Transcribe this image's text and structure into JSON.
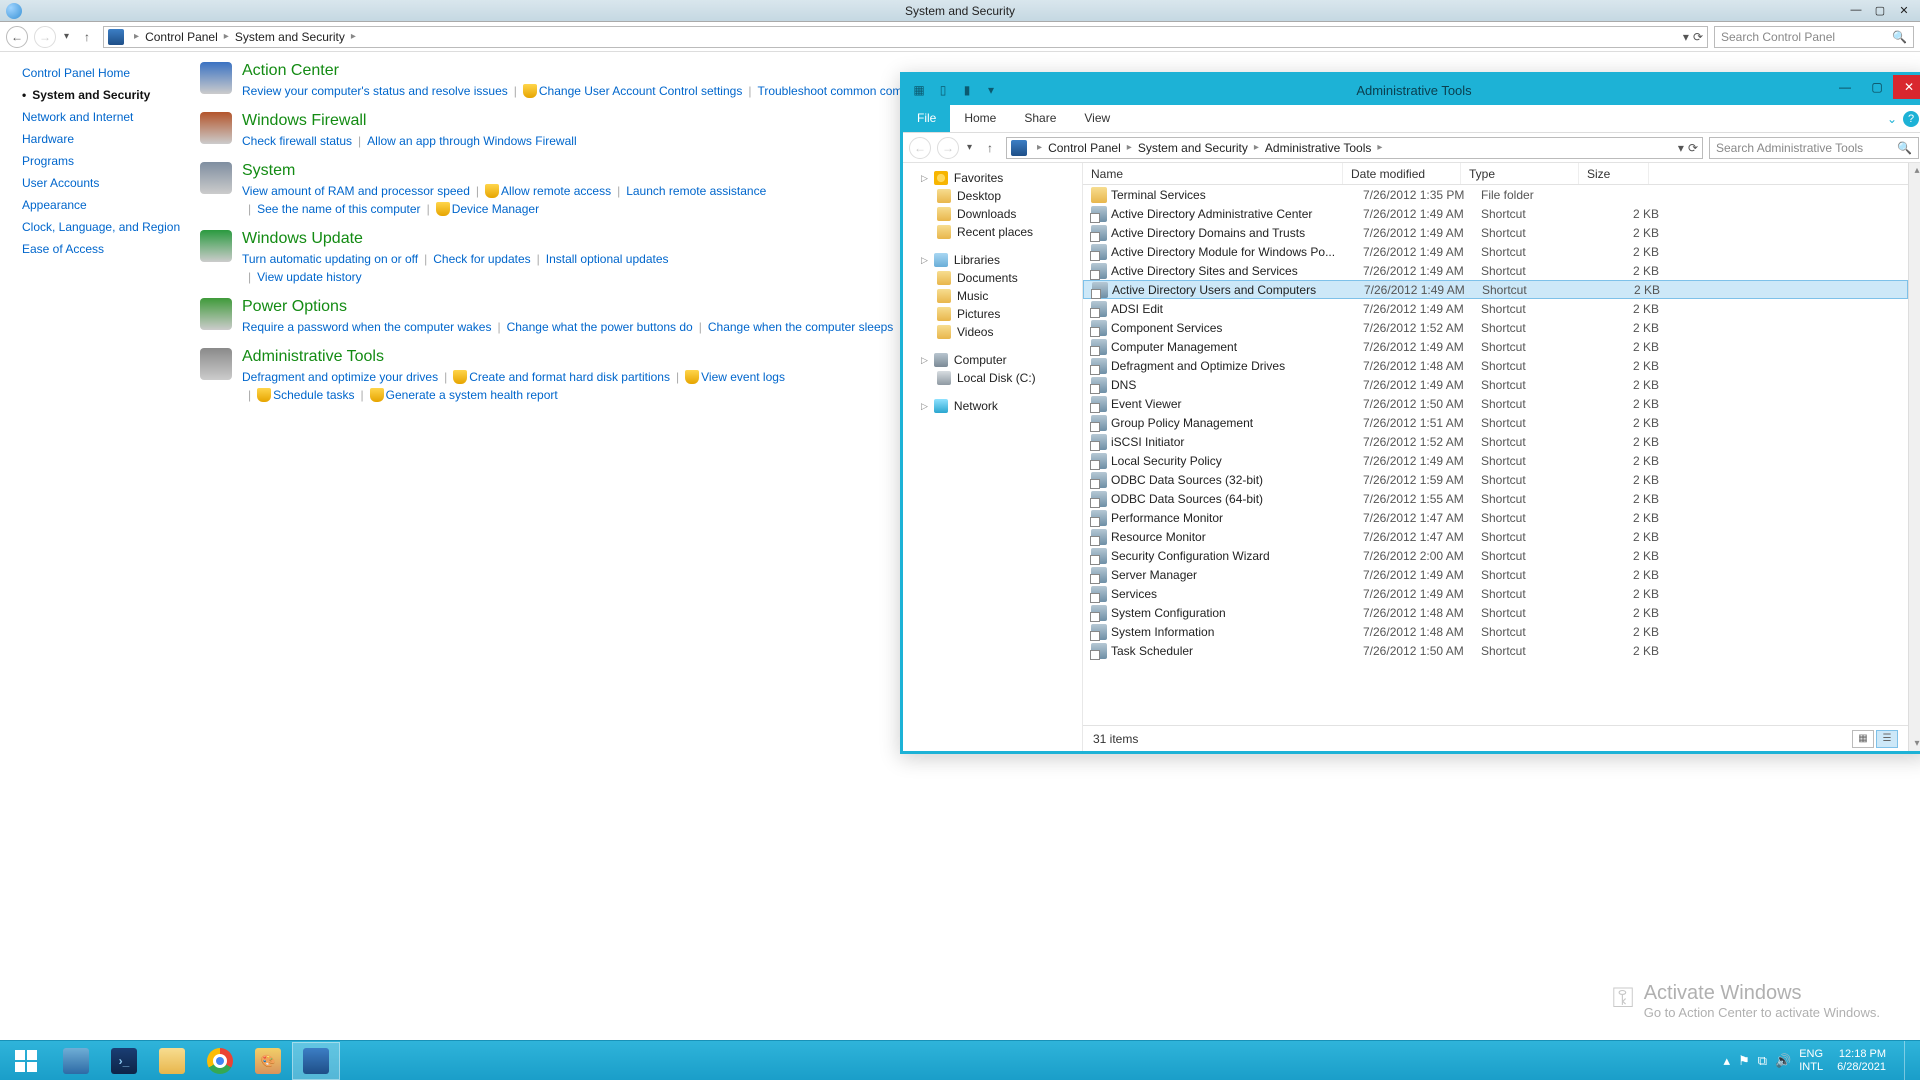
{
  "mainWindow": {
    "title": "System and Security",
    "breadcrumb": [
      "Control Panel",
      "System and Security"
    ],
    "searchPlaceholder": "Search Control Panel"
  },
  "sidebar": [
    {
      "label": "Control Panel Home",
      "active": false
    },
    {
      "label": "System and Security",
      "active": true
    },
    {
      "label": "Network and Internet",
      "active": false
    },
    {
      "label": "Hardware",
      "active": false
    },
    {
      "label": "Programs",
      "active": false
    },
    {
      "label": "User Accounts",
      "active": false
    },
    {
      "label": "Appearance",
      "active": false
    },
    {
      "label": "Clock, Language, and Region",
      "active": false
    },
    {
      "label": "Ease of Access",
      "active": false
    }
  ],
  "sections": [
    {
      "title": "Action Center",
      "links": [
        {
          "t": "Review your computer's status and resolve issues"
        },
        {
          "t": "Change User Account Control settings",
          "shield": true
        },
        {
          "t": "Troubleshoot common computer problems"
        }
      ],
      "icon": "#3a72c2"
    },
    {
      "title": "Windows Firewall",
      "links": [
        {
          "t": "Check firewall status"
        },
        {
          "t": "Allow an app through Windows Firewall"
        }
      ],
      "icon": "#b3552b"
    },
    {
      "title": "System",
      "links": [
        {
          "t": "View amount of RAM and processor speed"
        },
        {
          "t": "Allow remote access",
          "shield": true
        },
        {
          "t": "Launch remote assistance"
        },
        {
          "t": "See the name of this computer"
        },
        {
          "t": "Device Manager",
          "shield": true
        }
      ],
      "icon": "#7f8ea0"
    },
    {
      "title": "Windows Update",
      "links": [
        {
          "t": "Turn automatic updating on or off"
        },
        {
          "t": "Check for updates"
        },
        {
          "t": "Install optional updates"
        },
        {
          "t": "View update history"
        }
      ],
      "icon": "#2a9a3f"
    },
    {
      "title": "Power Options",
      "links": [
        {
          "t": "Require a password when the computer wakes"
        },
        {
          "t": "Change what the power buttons do"
        },
        {
          "t": "Change when the computer sleeps"
        }
      ],
      "icon": "#3f9a3a"
    },
    {
      "title": "Administrative Tools",
      "links": [
        {
          "t": "Defragment and optimize your drives"
        },
        {
          "t": "Create and format hard disk partitions",
          "shield": true
        },
        {
          "t": "View event logs",
          "shield": true
        },
        {
          "t": "Schedule tasks",
          "shield": true
        },
        {
          "t": "Generate a system health report",
          "shield": true
        }
      ],
      "icon": "#8a8a8a"
    }
  ],
  "subWindow": {
    "title": "Administrative Tools",
    "ribbonTabs": [
      "File",
      "Home",
      "Share",
      "View"
    ],
    "breadcrumb": [
      "Control Panel",
      "System and Security",
      "Administrative Tools"
    ],
    "searchPlaceholder": "Search Administrative Tools",
    "columns": [
      "Name",
      "Date modified",
      "Type",
      "Size"
    ],
    "status": "31 items",
    "navPane": [
      {
        "header": "Favorites",
        "icon": "icon-star",
        "items": [
          {
            "t": "Desktop",
            "icon": "icon-folder"
          },
          {
            "t": "Downloads",
            "icon": "icon-folder"
          },
          {
            "t": "Recent places",
            "icon": "icon-folder"
          }
        ]
      },
      {
        "header": "Libraries",
        "icon": "icon-lib",
        "items": [
          {
            "t": "Documents",
            "icon": "icon-folder"
          },
          {
            "t": "Music",
            "icon": "icon-folder"
          },
          {
            "t": "Pictures",
            "icon": "icon-folder"
          },
          {
            "t": "Videos",
            "icon": "icon-folder"
          }
        ]
      },
      {
        "header": "Computer",
        "icon": "icon-comp",
        "items": [
          {
            "t": "Local Disk (C:)",
            "icon": "icon-disk"
          }
        ]
      },
      {
        "header": "Network",
        "icon": "icon-net",
        "items": []
      }
    ],
    "files": [
      {
        "name": "Terminal Services",
        "date": "7/26/2012 1:35 PM",
        "type": "File folder",
        "size": "",
        "icon": "ffolder"
      },
      {
        "name": "Active Directory Administrative Center",
        "date": "7/26/2012 1:49 AM",
        "type": "Shortcut",
        "size": "2 KB",
        "icon": "fshortcut"
      },
      {
        "name": "Active Directory Domains and Trusts",
        "date": "7/26/2012 1:49 AM",
        "type": "Shortcut",
        "size": "2 KB",
        "icon": "fshortcut"
      },
      {
        "name": "Active Directory Module for Windows Po...",
        "date": "7/26/2012 1:49 AM",
        "type": "Shortcut",
        "size": "2 KB",
        "icon": "fshortcut"
      },
      {
        "name": "Active Directory Sites and Services",
        "date": "7/26/2012 1:49 AM",
        "type": "Shortcut",
        "size": "2 KB",
        "icon": "fshortcut"
      },
      {
        "name": "Active Directory Users and Computers",
        "date": "7/26/2012 1:49 AM",
        "type": "Shortcut",
        "size": "2 KB",
        "icon": "fshortcut",
        "selected": true
      },
      {
        "name": "ADSI Edit",
        "date": "7/26/2012 1:49 AM",
        "type": "Shortcut",
        "size": "2 KB",
        "icon": "fshortcut"
      },
      {
        "name": "Component Services",
        "date": "7/26/2012 1:52 AM",
        "type": "Shortcut",
        "size": "2 KB",
        "icon": "fshortcut"
      },
      {
        "name": "Computer Management",
        "date": "7/26/2012 1:49 AM",
        "type": "Shortcut",
        "size": "2 KB",
        "icon": "fshortcut"
      },
      {
        "name": "Defragment and Optimize Drives",
        "date": "7/26/2012 1:48 AM",
        "type": "Shortcut",
        "size": "2 KB",
        "icon": "fshortcut"
      },
      {
        "name": "DNS",
        "date": "7/26/2012 1:49 AM",
        "type": "Shortcut",
        "size": "2 KB",
        "icon": "fshortcut"
      },
      {
        "name": "Event Viewer",
        "date": "7/26/2012 1:50 AM",
        "type": "Shortcut",
        "size": "2 KB",
        "icon": "fshortcut"
      },
      {
        "name": "Group Policy Management",
        "date": "7/26/2012 1:51 AM",
        "type": "Shortcut",
        "size": "2 KB",
        "icon": "fshortcut"
      },
      {
        "name": "iSCSI Initiator",
        "date": "7/26/2012 1:52 AM",
        "type": "Shortcut",
        "size": "2 KB",
        "icon": "fshortcut"
      },
      {
        "name": "Local Security Policy",
        "date": "7/26/2012 1:49 AM",
        "type": "Shortcut",
        "size": "2 KB",
        "icon": "fshortcut"
      },
      {
        "name": "ODBC Data Sources (32-bit)",
        "date": "7/26/2012 1:59 AM",
        "type": "Shortcut",
        "size": "2 KB",
        "icon": "fshortcut"
      },
      {
        "name": "ODBC Data Sources (64-bit)",
        "date": "7/26/2012 1:55 AM",
        "type": "Shortcut",
        "size": "2 KB",
        "icon": "fshortcut"
      },
      {
        "name": "Performance Monitor",
        "date": "7/26/2012 1:47 AM",
        "type": "Shortcut",
        "size": "2 KB",
        "icon": "fshortcut"
      },
      {
        "name": "Resource Monitor",
        "date": "7/26/2012 1:47 AM",
        "type": "Shortcut",
        "size": "2 KB",
        "icon": "fshortcut"
      },
      {
        "name": "Security Configuration Wizard",
        "date": "7/26/2012 2:00 AM",
        "type": "Shortcut",
        "size": "2 KB",
        "icon": "fshortcut"
      },
      {
        "name": "Server Manager",
        "date": "7/26/2012 1:49 AM",
        "type": "Shortcut",
        "size": "2 KB",
        "icon": "fshortcut"
      },
      {
        "name": "Services",
        "date": "7/26/2012 1:49 AM",
        "type": "Shortcut",
        "size": "2 KB",
        "icon": "fshortcut"
      },
      {
        "name": "System Configuration",
        "date": "7/26/2012 1:48 AM",
        "type": "Shortcut",
        "size": "2 KB",
        "icon": "fshortcut"
      },
      {
        "name": "System Information",
        "date": "7/26/2012 1:48 AM",
        "type": "Shortcut",
        "size": "2 KB",
        "icon": "fshortcut"
      },
      {
        "name": "Task Scheduler",
        "date": "7/26/2012 1:50 AM",
        "type": "Shortcut",
        "size": "2 KB",
        "icon": "fshortcut"
      }
    ]
  },
  "watermark": {
    "t1": "Activate Windows",
    "t2": "Go to Action Center to activate Windows."
  },
  "taskbar": {
    "lang1": "ENG",
    "lang2": "INTL",
    "time": "12:18 PM",
    "date": "6/28/2021"
  }
}
